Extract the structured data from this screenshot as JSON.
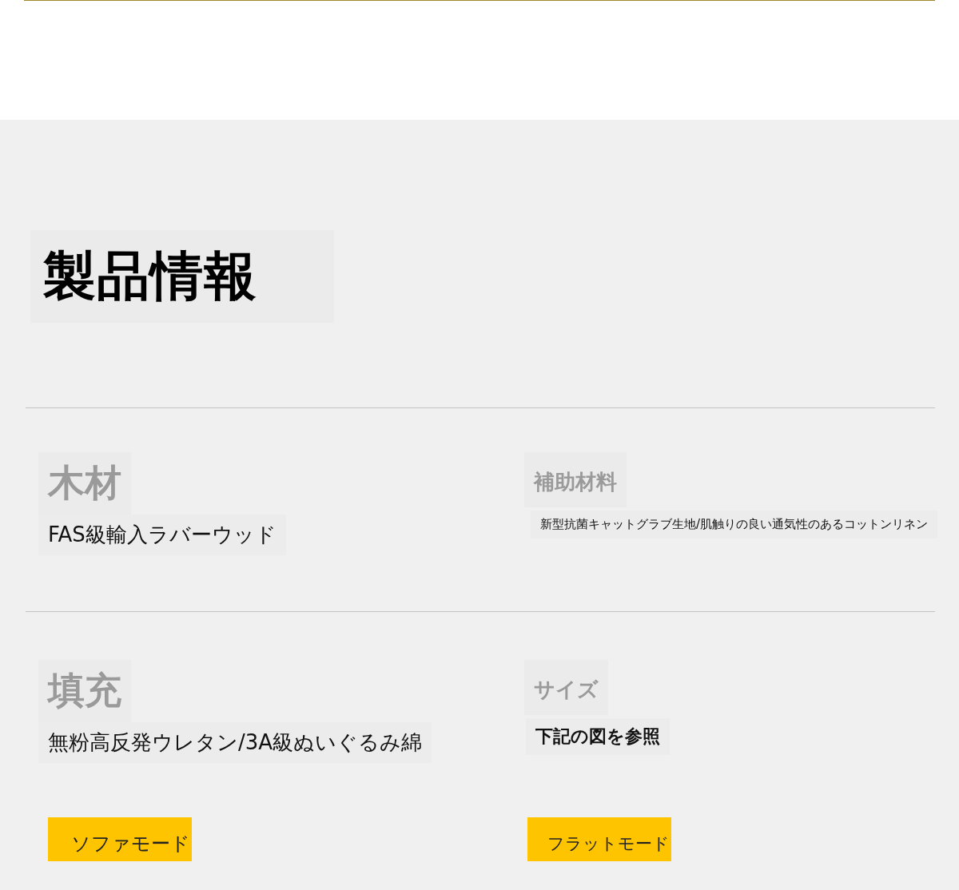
{
  "heading": "製品情報",
  "spec_rows": [
    {
      "items": [
        {
          "label": "木材",
          "value": "FAS級輸入ラバーウッド",
          "bold": false
        },
        {
          "label": "補助材料",
          "value": "新型抗菌キャットグラブ生地/肌触りの良い通気性のあるコットンリネン",
          "bold": false
        }
      ]
    },
    {
      "items": [
        {
          "label": "填充",
          "value": "無粉高反発ウレタン/3A級ぬいぐるみ綿",
          "bold": false
        },
        {
          "label": "サイズ",
          "value": "下記の図を参照",
          "bold": true
        }
      ]
    }
  ],
  "buttons": [
    "ソファモード",
    "フラットモード"
  ]
}
